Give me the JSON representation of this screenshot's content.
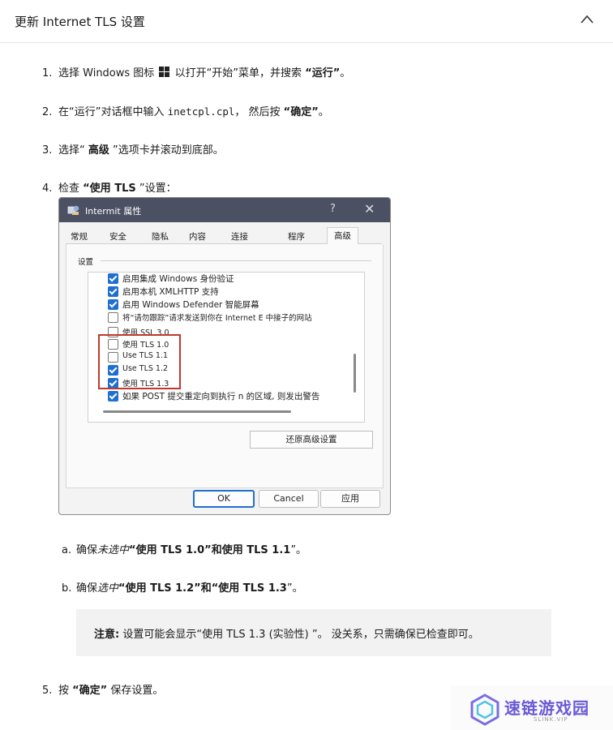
{
  "header": {
    "title": "更新 Internet TLS 设置"
  },
  "steps": [
    {
      "num": "1.",
      "pre": "选择 Windows 图标 ",
      "post": " 以打开“开始”菜单，并搜索 ",
      "bold": "“运行”",
      "end": "。"
    },
    {
      "num": "2.",
      "pre": "在“运行”对话框中输入 ",
      "code": "inetcpl.cpl",
      "mid": "， 然后按 ",
      "bold": "“确定”",
      "end": "。"
    },
    {
      "num": "3.",
      "pre": "选择“ ",
      "bold": "高级",
      "end": " ”选项卡并滚动到底部。"
    },
    {
      "num": "4.",
      "pre": "检查 ",
      "bold": "“使用 TLS",
      "end": " ”设置："
    },
    {
      "num": "5.",
      "pre": "按 ",
      "bold": "“确定”",
      "end": " 保存设置。"
    }
  ],
  "dialog": {
    "title": "Intermit 属性",
    "help": "?",
    "close": "✕",
    "tabs": [
      "常规",
      "安全",
      "隐私",
      "内容",
      "连接",
      "程序",
      "高级"
    ],
    "group_label": "设置",
    "items": [
      {
        "label": "启用集成 Windows 身份验证",
        "checked": true
      },
      {
        "label": "启用本机 XMLHTTP 支持",
        "checked": true
      },
      {
        "label": "启用 Windows Defender 智能屏幕",
        "checked": true
      },
      {
        "label": "将“请勿跟踪”请求发送到你在 Internet E 中接子的网站",
        "checked": false
      },
      {
        "label": "使用 SSL 3.0",
        "checked": false
      },
      {
        "label": "使用 TLS 1.0",
        "checked": false
      },
      {
        "label": "Use TLS 1.1",
        "checked": false
      },
      {
        "label": "Use TLS 1.2",
        "checked": true
      },
      {
        "label": "使用 TLS 1.3",
        "checked": true
      },
      {
        "label": "如果 POST 提交重定向到执行 n 的区域, 则发出警告",
        "checked": true
      }
    ],
    "restore_label": "还原高级设置",
    "ok_label": "OK",
    "cancel_label": "Cancel",
    "apply_label": "应用"
  },
  "substeps": [
    {
      "num": "a.",
      "pre": "确保",
      "em": "未选中",
      "bold": "“使用 TLS 1.0”和使用 TLS 1.1",
      "end": "”。"
    },
    {
      "num": "b.",
      "pre": "确保",
      "em": "选中",
      "bold": "“使用 TLS 1.2”和“使用 TLS 1.3",
      "end": "”。"
    }
  ],
  "note": {
    "label": "注意:",
    "text": " 设置可能会显示“使用 TLS 1.3 (实验性) ”。 没关系，只需确保已检查即可。"
  },
  "watermark": {
    "text": "速链游戏园",
    "sub": "SLINK.VIP"
  }
}
